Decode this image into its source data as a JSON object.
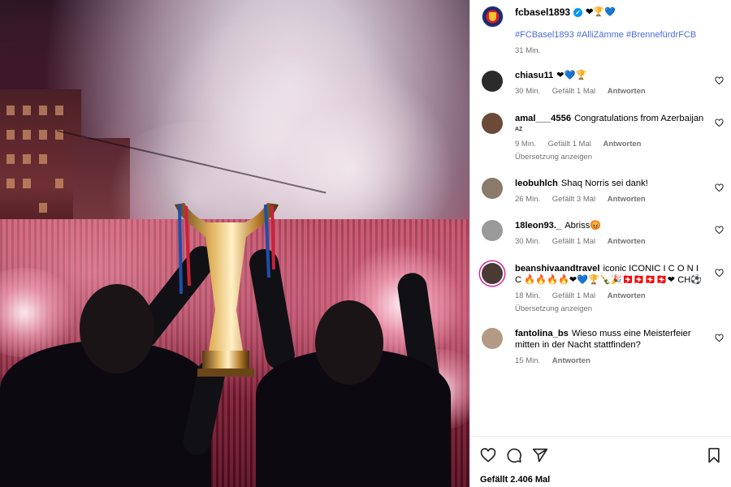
{
  "post": {
    "owner": "fcbasel1893",
    "owner_emojis": "❤🏆💙",
    "hashtags": [
      "#FCBasel1893",
      "#AlliZämme",
      "#BrennefürdrFCB"
    ],
    "time": "31 Min."
  },
  "comments": [
    {
      "user": "chiasu11",
      "text": "❤💙🏆",
      "time": "30 Min.",
      "likes": "Gefällt 1 Mal",
      "reply": "Antworten",
      "translate": "",
      "avatar_color": "#2b2b2b"
    },
    {
      "user": "amal___4556",
      "text": "Congratulations from Azerbaijan",
      "flag": "AZ",
      "time": "9 Min.",
      "likes": "Gefällt 1 Mal",
      "reply": "Antworten",
      "translate": "Übersetzung anzeigen",
      "avatar_color": "#6b4a3a"
    },
    {
      "user": "leobuhlch",
      "text": "Shaq Norris sei dank!",
      "time": "26 Min.",
      "likes": "Gefällt 3 Mal",
      "reply": "Antworten",
      "translate": "",
      "avatar_color": "#8a7a6a"
    },
    {
      "user": "18leon93._",
      "text": "Abriss😡",
      "time": "30 Min.",
      "likes": "Gefällt 1 Mal",
      "reply": "Antworten",
      "translate": "",
      "avatar_color": "#9a9a9a"
    },
    {
      "user": "beanshivaandtravel",
      "text": "iconic ICONIC I C O N I C 🔥🔥🔥🔥❤💙🏆🍾🎉🇨🇭🇨🇭🇨🇭🇨🇭❤",
      "text2": "CH⚽",
      "time": "18 Min.",
      "likes": "Gefällt 1 Mal",
      "reply": "Antworten",
      "translate": "Übersetzung anzeigen",
      "avatar_color": "#4a3a34"
    },
    {
      "user": "fantolina_bs",
      "text": "Wieso muss eine Meisterfeier mitten in der Nacht stattfinden?",
      "time": "15 Min.",
      "likes": "",
      "reply": "Antworten",
      "translate": "",
      "avatar_color": "#b49a84"
    }
  ],
  "footer": {
    "likes": "Gefällt 2.406 Mal"
  },
  "icons": [
    "heart-icon",
    "comment-icon",
    "share-icon",
    "bookmark-icon"
  ],
  "colors": {
    "link": "#4a6dd8",
    "verified": "#0095f6",
    "meta": "#737373"
  }
}
